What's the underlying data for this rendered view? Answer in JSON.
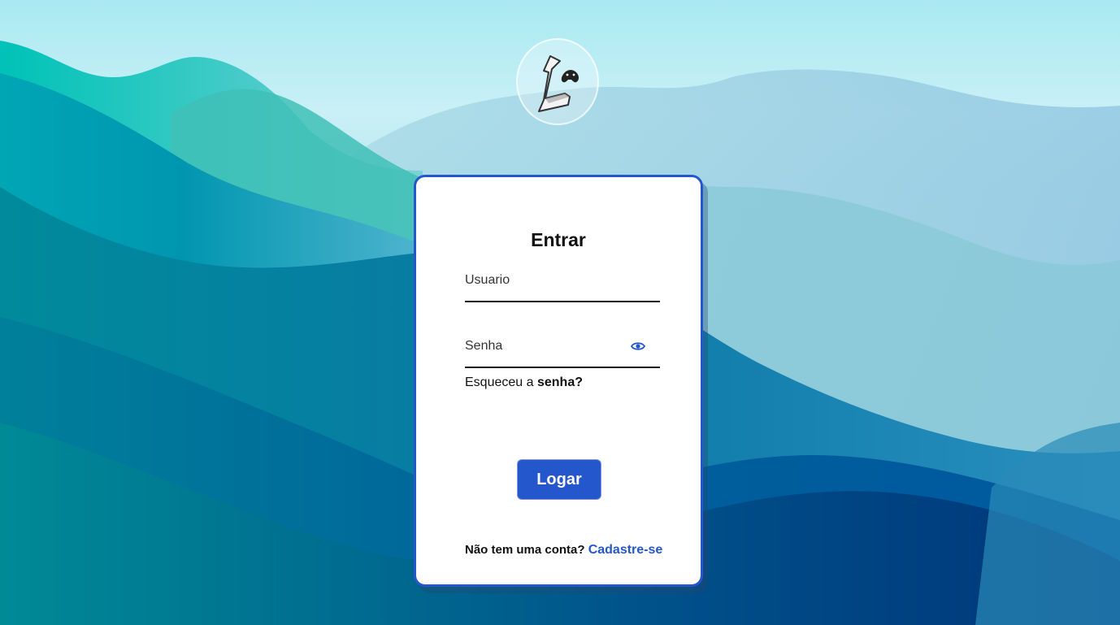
{
  "login": {
    "title": "Entrar",
    "username_placeholder": "Usuario",
    "password_placeholder": "Senha",
    "forgot_prefix": "Esqueceu a",
    "forgot_link": "senha?",
    "submit_label": "Logar",
    "signup_prompt": "Não tem uma conta?",
    "signup_link": "Cadastre-se"
  },
  "icons": {
    "logo": "game-controller-logo-icon",
    "password_toggle": "eye-icon"
  },
  "colors": {
    "accent": "#2456cc",
    "card_background": "#ffffff",
    "text": "#111111"
  }
}
